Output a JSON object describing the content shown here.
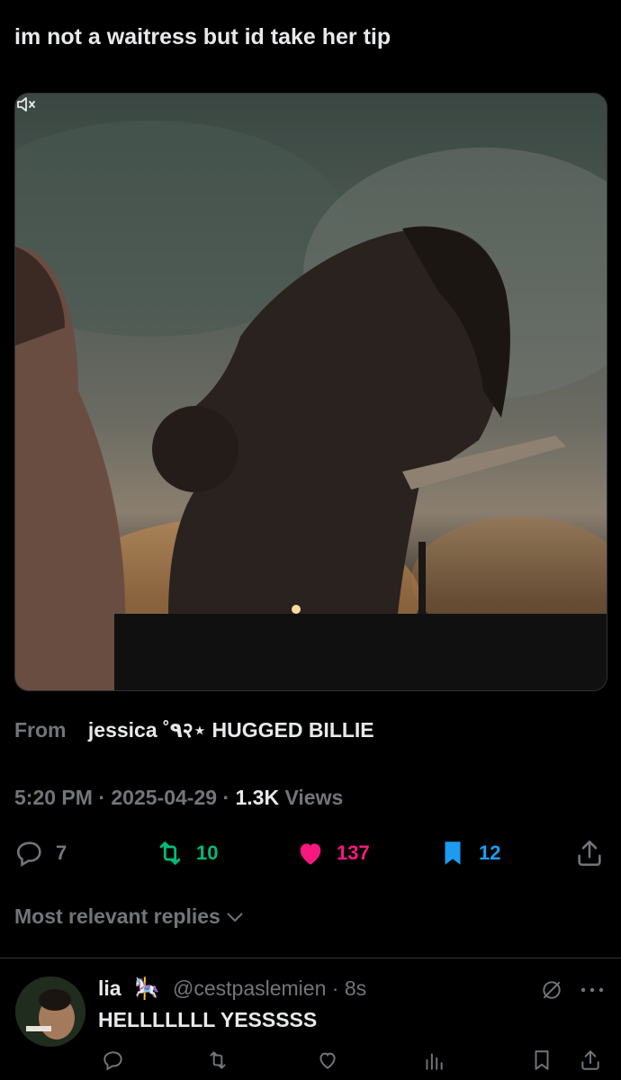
{
  "post": {
    "text": "im not a waitress but id take her tip"
  },
  "media": {
    "icons": {
      "mute": "speaker-muted-icon"
    }
  },
  "source": {
    "label": "From",
    "name": "jessica ˚٩२⋆ HUGGED BILLIE"
  },
  "meta": {
    "time": "5:20 PM",
    "date": "2025-04-29",
    "views_count": "1.3K",
    "views_label": "Views",
    "separator": "·"
  },
  "actions": {
    "replies": "7",
    "reposts": "10",
    "likes": "137",
    "bookmarks": "12",
    "colors": {
      "repost": "#00ba7c",
      "like": "#f91880",
      "bookmark": "#1d9bf0",
      "muted": "#71767b"
    }
  },
  "replies_header": {
    "label": "Most relevant replies"
  },
  "reply": {
    "name": "lia",
    "emoji": "🎠",
    "handle": "@cestpaslemien",
    "separator": "·",
    "time": "8s",
    "text": "HELLLLLLL YESSSSS"
  }
}
